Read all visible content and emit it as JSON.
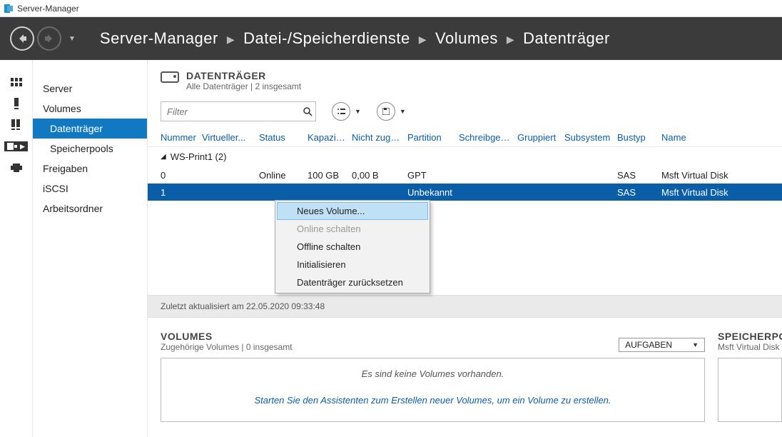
{
  "window": {
    "title": "Server-Manager"
  },
  "breadcrumb": [
    "Server-Manager",
    "Datei-/Speicherdienste",
    "Volumes",
    "Datenträger"
  ],
  "sidenav": {
    "items": [
      {
        "label": "Server",
        "sub": false
      },
      {
        "label": "Volumes",
        "sub": false
      },
      {
        "label": "Datenträger",
        "sub": true,
        "selected": true
      },
      {
        "label": "Speicherpools",
        "sub": true
      },
      {
        "label": "Freigaben",
        "sub": false
      },
      {
        "label": "iSCSI",
        "sub": false
      },
      {
        "label": "Arbeitsordner",
        "sub": false
      }
    ]
  },
  "disks": {
    "heading": "DATENTRÄGER",
    "subheading": "Alle Datenträger | 2 insgesamt",
    "filter_placeholder": "Filter",
    "columns": {
      "number": "Nummer",
      "virtual": "Virtueller...",
      "status": "Status",
      "capacity": "Kapazit...",
      "free": "Nicht zuge...",
      "partition": "Partition",
      "write": "Schreibges...",
      "grouped": "Gruppiert",
      "subsystem": "Subsystem",
      "bustype": "Bustyp",
      "name": "Name"
    },
    "group_label": "WS-Print1 (2)",
    "rows": [
      {
        "number": "0",
        "virtual": "",
        "status": "Online",
        "capacity": "100 GB",
        "free": "0,00 B",
        "partition": "GPT",
        "write": "",
        "grouped": "",
        "subsystem": "",
        "bustype": "SAS",
        "name": "Msft Virtual Disk"
      },
      {
        "number": "1",
        "virtual": "",
        "status": "",
        "capacity": "",
        "free": "",
        "partition": "Unbekannt",
        "write": "",
        "grouped": "",
        "subsystem": "",
        "bustype": "SAS",
        "name": "Msft Virtual Disk"
      }
    ],
    "status_line": "Zuletzt aktualisiert am 22.05.2020 09:33:48"
  },
  "context_menu": {
    "items": [
      {
        "label": "Neues Volume...",
        "state": "hover"
      },
      {
        "label": "Online schalten",
        "state": "disabled"
      },
      {
        "label": "Offline schalten",
        "state": "normal"
      },
      {
        "label": "Initialisieren",
        "state": "normal"
      },
      {
        "label": "Datenträger zurücksetzen",
        "state": "normal"
      }
    ]
  },
  "volumes_panel": {
    "title": "VOLUMES",
    "subtitle": "Zugehörige Volumes | 0 insgesamt",
    "tasks_label": "AUFGABEN",
    "empty_line1": "Es sind keine Volumes vorhanden.",
    "empty_line2": "Starten Sie den Assistenten zum Erstellen neuer Volumes, um ein Volume zu erstellen."
  },
  "pool_panel": {
    "title": "SPEICHERPOOL",
    "subtitle": "Msft Virtual Disk auf "
  }
}
